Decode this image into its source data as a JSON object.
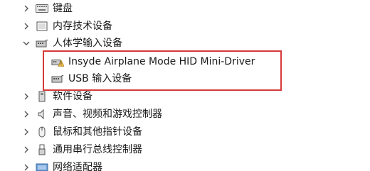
{
  "device_tree": {
    "items": [
      {
        "label": "键盘",
        "state": "collapsed",
        "icon": "keyboard-icon"
      },
      {
        "label": "内存技术设备",
        "state": "collapsed",
        "icon": "memory-device-icon"
      },
      {
        "label": "人体学输入设备",
        "state": "expanded",
        "icon": "hid-device-icon",
        "children": [
          {
            "label": "Insyde Airplane Mode HID Mini-Driver",
            "icon": "warning-device-icon"
          },
          {
            "label": "USB 输入设备",
            "icon": "hid-device-icon"
          }
        ]
      },
      {
        "label": "软件设备",
        "state": "collapsed",
        "icon": "software-device-icon"
      },
      {
        "label": "声音、视频和游戏控制器",
        "state": "collapsed",
        "icon": "speaker-icon"
      },
      {
        "label": "鼠标和其他指针设备",
        "state": "collapsed",
        "icon": "mouse-icon"
      },
      {
        "label": "通用串行总线控制器",
        "state": "collapsed",
        "icon": "usb-icon"
      },
      {
        "label": "网络适配器",
        "state": "collapsed",
        "icon": "network-adapter-icon"
      }
    ]
  },
  "colors": {
    "highlight_border": "#d63a3a",
    "text": "#1a1a1a",
    "chevron": "#555555"
  }
}
